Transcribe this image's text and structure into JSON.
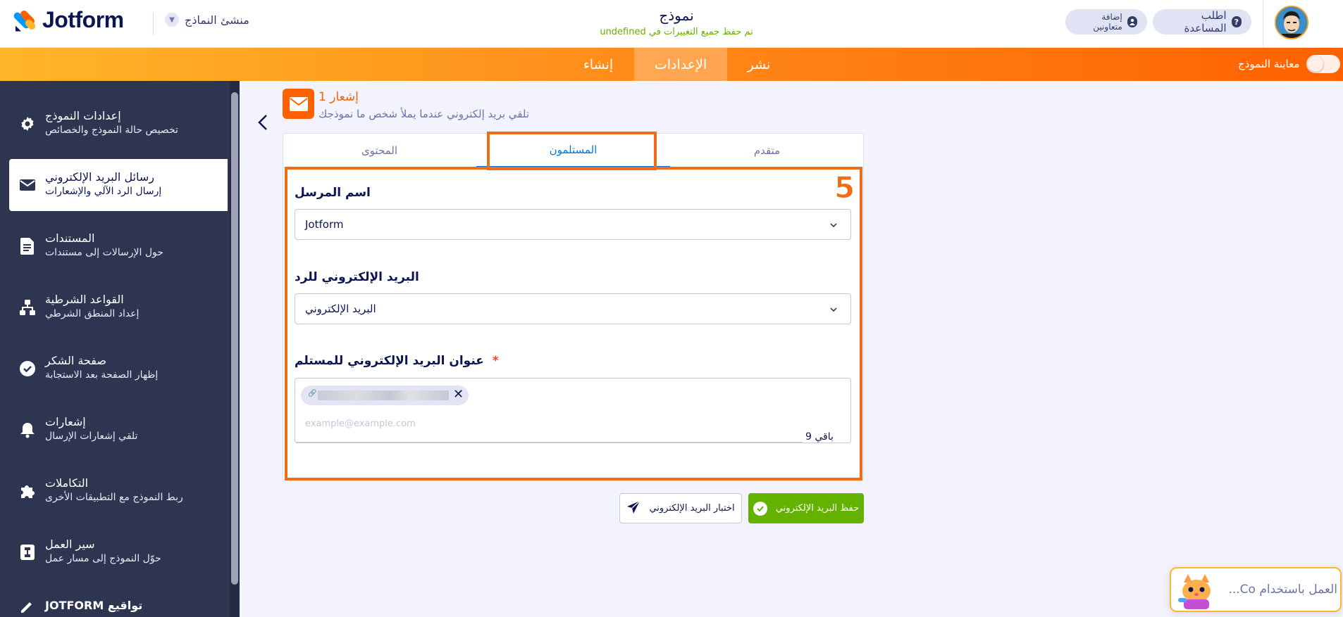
{
  "header": {
    "logo_text": "Jotform",
    "form_builder_label": "منشئ النماذج",
    "form_title": "نموذج",
    "saved_status": "تم حفظ جميع التغييرات في undefined",
    "help_label": "اطلب المساعدة",
    "invite_label": "إضافة متعاونين"
  },
  "nav": {
    "create": "إنشاء",
    "settings": "الإعدادات",
    "publish": "نشر",
    "preview_label": "معاينة النموذج"
  },
  "sidebar": {
    "items": [
      {
        "title": "إعدادات النموذج",
        "sub": "تخصيص حالة النموذج والخصائص",
        "icon": "gear-icon"
      },
      {
        "title": "رسائل البريد الإلكتروني",
        "sub": "إرسال الرد الآلي والإشعارات",
        "icon": "envelope-icon"
      },
      {
        "title": "المستندات",
        "sub": "حول الإرسالات إلى مستندات",
        "icon": "document-icon"
      },
      {
        "title": "القواعد الشرطية",
        "sub": "إعداد المنطق الشرطي",
        "icon": "hierarchy-icon"
      },
      {
        "title": "صفحة الشكر",
        "sub": "إظهار الصفحة بعد الاستجابة",
        "icon": "check-circle-icon"
      },
      {
        "title": "إشعارات",
        "sub": "تلقي إشعارات الإرسال",
        "icon": "bell-icon"
      },
      {
        "title": "التكاملات",
        "sub": "ربط النموذج مع التطبيقات الأخرى",
        "icon": "puzzle-icon"
      },
      {
        "title": "سير العمل",
        "sub": "حوّل النموذج إلى مسار عمل",
        "icon": "workflow-icon"
      },
      {
        "title": "JOTFORM تواقيع",
        "sub": "",
        "icon": "signature-icon"
      }
    ]
  },
  "notification": {
    "heading": "إشعار 1",
    "sub": "تلقي بريد إلكتروني عندما يملأ شخص ما نموذجك"
  },
  "tabs": {
    "content": "المحتوى",
    "recipients": "المستلمون",
    "advanced": "متقدم"
  },
  "annotation": {
    "step": "5"
  },
  "fields": {
    "sender_name_label": "اسم المرسل",
    "sender_name_value": "Jotform",
    "reply_to_label": "البريد الإلكتروني للرد",
    "reply_to_value": "البريد الإلكتروني",
    "recipient_label": "عنوان البريد الإلكتروني للمستلم",
    "recipient_required": "*",
    "recipient_placeholder": "example@example.com",
    "remaining": "باقي 9"
  },
  "buttons": {
    "save": "حفظ البريد الإلكتروني",
    "test": "اختبار البريد الإلكتروني"
  },
  "ai_widget": {
    "text": "العمل باستخدام Co..."
  },
  "colors": {
    "accent_orange": "#ff6100",
    "sidebar_bg": "#2e3551",
    "primary_blue": "#0075e3",
    "save_green": "#64b200"
  }
}
